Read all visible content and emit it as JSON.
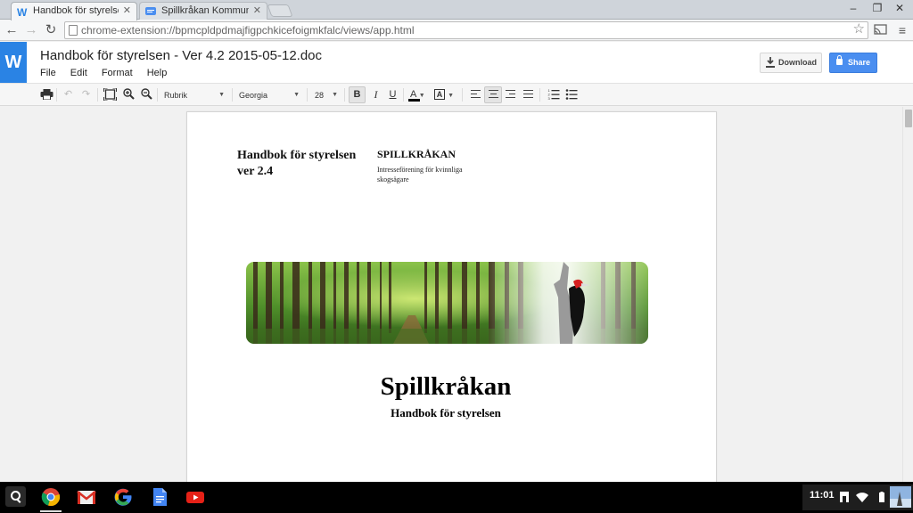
{
  "browser": {
    "tabs": [
      {
        "title": "Handbok för styrelsen - Ve",
        "active": true
      },
      {
        "title": "Spillkråkan Kommunikatio",
        "active": false
      }
    ],
    "address": "chrome-extension://bpmcpldpdmajfigpchkicefoigmkfalc/views/app.html"
  },
  "app": {
    "logo_letter": "W",
    "doc_title": "Handbok för styrelsen - Ver 4.2 2015-05-12.doc",
    "menu": [
      "File",
      "Edit",
      "Format",
      "Help"
    ],
    "download_label": "Download",
    "share_label": "Share",
    "accent_color": "#2a83e4"
  },
  "format_toolbar": {
    "style": "Rubrik",
    "font": "Georgia",
    "size": "28",
    "bold_label": "B",
    "italic_label": "I",
    "underline_label": "U",
    "font_color_label": "A",
    "highlight_label": "A",
    "alignment": "center",
    "bold_active": true
  },
  "document": {
    "header_left_line1": "Handbok för styrelsen",
    "header_left_line2": "ver 2.4",
    "header_right_title": "SPILLKRÅKAN",
    "header_right_sub": "Intresseförening för kvinnliga skogsägare",
    "title": "Spillkråkan",
    "subtitle": "Handbok för styrelsen"
  },
  "shelf": {
    "apps": [
      "chrome-icon",
      "gmail-icon",
      "google-icon",
      "docs-icon",
      "youtube-icon"
    ],
    "clock": "11:01"
  }
}
